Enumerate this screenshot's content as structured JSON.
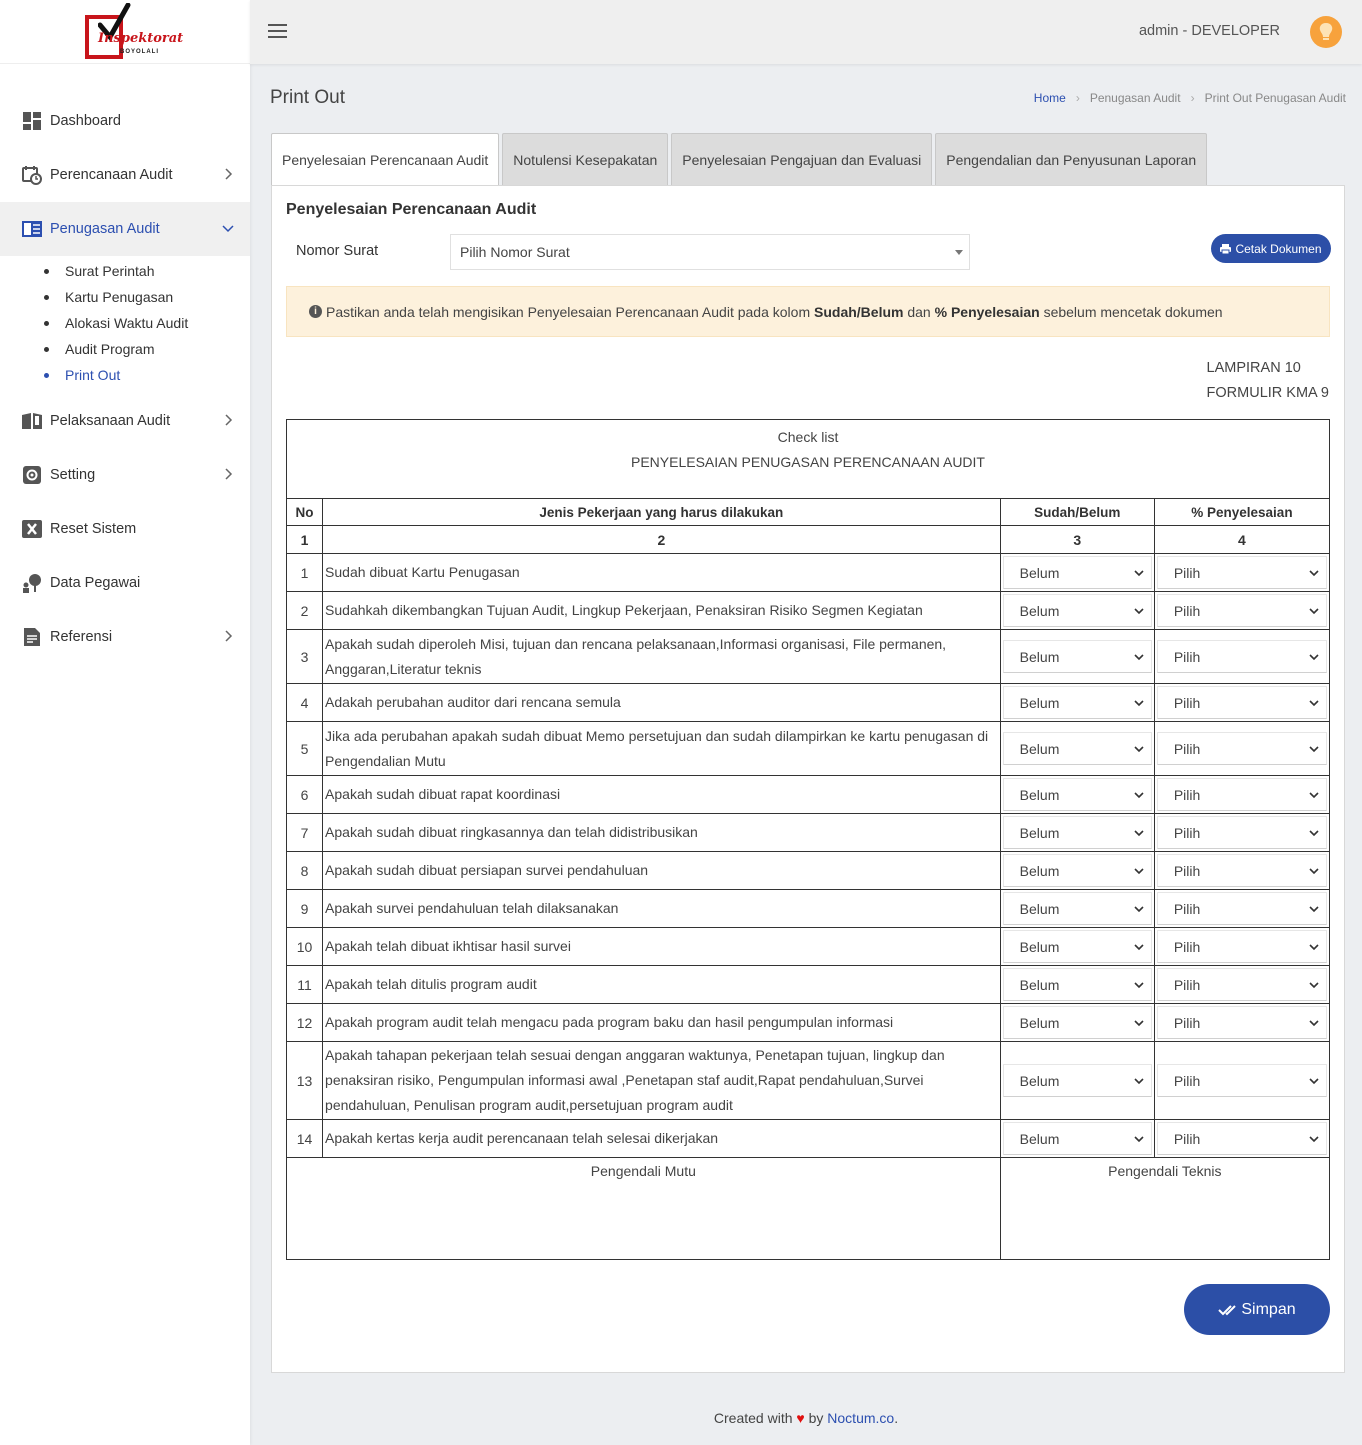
{
  "sidebar": {
    "logo_text": "Inspektorat",
    "logo_sub": "BOYOLALI",
    "items": [
      {
        "label": "Dashboard"
      },
      {
        "label": "Perencanaan Audit"
      },
      {
        "label": "Penugasan Audit"
      },
      {
        "label": "Pelaksanaan Audit"
      },
      {
        "label": "Setting"
      },
      {
        "label": "Reset Sistem"
      },
      {
        "label": "Data Pegawai"
      },
      {
        "label": "Referensi"
      }
    ],
    "submenu": [
      "Surat Perintah",
      "Kartu Penugasan",
      "Alokasi Waktu Audit",
      "Audit Program",
      "Print Out"
    ]
  },
  "header": {
    "user": "admin - DEVELOPER"
  },
  "page": {
    "title": "Print Out",
    "breadcrumb": [
      "Home",
      "Penugasan Audit",
      "Print Out Penugasan Audit"
    ]
  },
  "tabs": [
    "Penyelesaian Perencanaan Audit",
    "Notulensi Kesepakatan",
    "Penyelesaian Pengajuan dan Evaluasi",
    "Pengendalian dan Penyusunan Laporan"
  ],
  "form": {
    "title": "Penyelesaian Perencanaan Audit",
    "nomor_label": "Nomor Surat",
    "nomor_value": "Pilih Nomor Surat",
    "cetak_label": "Cetak Dokumen",
    "alert_pre": "Pastikan anda telah mengisikan Penyelesaian Perencanaan Audit pada kolom",
    "alert_b1": "Sudah/Belum",
    "alert_mid": "dan",
    "alert_b2": "% Penyelesaian",
    "alert_post": "sebelum mencetak dokumen",
    "lampiran": "LAMPIRAN 10",
    "formulir": "FORMULIR KMA 9",
    "simpan_label": "Simpan"
  },
  "checklist": {
    "title1": "Check list",
    "title2": "PENYELESAIAN PENUGASAN PERENCANAAN AUDIT",
    "headers": [
      "No",
      "Jenis Pekerjaan yang harus dilakukan",
      "Sudah/Belum",
      "% Penyelesaian"
    ],
    "numbers": [
      "1",
      "2",
      "3",
      "4"
    ],
    "rows": [
      {
        "no": "1",
        "job": "Sudah dibuat Kartu Penugasan",
        "status": "Belum",
        "pct": "Pilih"
      },
      {
        "no": "2",
        "job": "Sudahkah dikembangkan Tujuan Audit, Lingkup Pekerjaan, Penaksiran Risiko Segmen Kegiatan",
        "status": "Belum",
        "pct": "Pilih"
      },
      {
        "no": "3",
        "job": "Apakah sudah diperoleh Misi, tujuan dan rencana pelaksanaan,Informasi organisasi, File permanen, Anggaran,Literatur teknis",
        "status": "Belum",
        "pct": "Pilih"
      },
      {
        "no": "4",
        "job": "Adakah perubahan auditor dari rencana semula",
        "status": "Belum",
        "pct": "Pilih"
      },
      {
        "no": "5",
        "job": "Jika ada perubahan apakah sudah dibuat Memo persetujuan dan sudah dilampirkan ke kartu penugasan di Pengendalian Mutu",
        "status": "Belum",
        "pct": "Pilih"
      },
      {
        "no": "6",
        "job": "Apakah sudah dibuat rapat koordinasi",
        "status": "Belum",
        "pct": "Pilih"
      },
      {
        "no": "7",
        "job": "Apakah sudah dibuat ringkasannya dan telah didistribusikan",
        "status": "Belum",
        "pct": "Pilih"
      },
      {
        "no": "8",
        "job": "Apakah sudah dibuat persiapan survei pendahuluan",
        "status": "Belum",
        "pct": "Pilih"
      },
      {
        "no": "9",
        "job": "Apakah survei pendahuluan telah dilaksanakan",
        "status": "Belum",
        "pct": "Pilih"
      },
      {
        "no": "10",
        "job": "Apakah telah dibuat ikhtisar hasil survei",
        "status": "Belum",
        "pct": "Pilih"
      },
      {
        "no": "11",
        "job": "Apakah telah ditulis program audit",
        "status": "Belum",
        "pct": "Pilih"
      },
      {
        "no": "12",
        "job": "Apakah program audit telah mengacu pada program baku dan hasil pengumpulan informasi",
        "status": "Belum",
        "pct": "Pilih"
      },
      {
        "no": "13",
        "job": "Apakah tahapan pekerjaan telah sesuai dengan anggaran waktunya, Penetapan tujuan, lingkup dan penaksiran risiko, Pengumpulan informasi awal ,Penetapan staf audit,Rapat pendahuluan,Survei pendahuluan, Penulisan program audit,persetujuan program audit",
        "status": "Belum",
        "pct": "Pilih"
      },
      {
        "no": "14",
        "job": "Apakah kertas kerja audit perencanaan telah selesai dikerjakan",
        "status": "Belum",
        "pct": "Pilih"
      }
    ],
    "sign_left": "Pengendali Mutu",
    "sign_right": "Pengendali Teknis"
  },
  "footer": {
    "pre": "Created with",
    "by": "by",
    "brand": "Noctum.co",
    "dot": "."
  }
}
